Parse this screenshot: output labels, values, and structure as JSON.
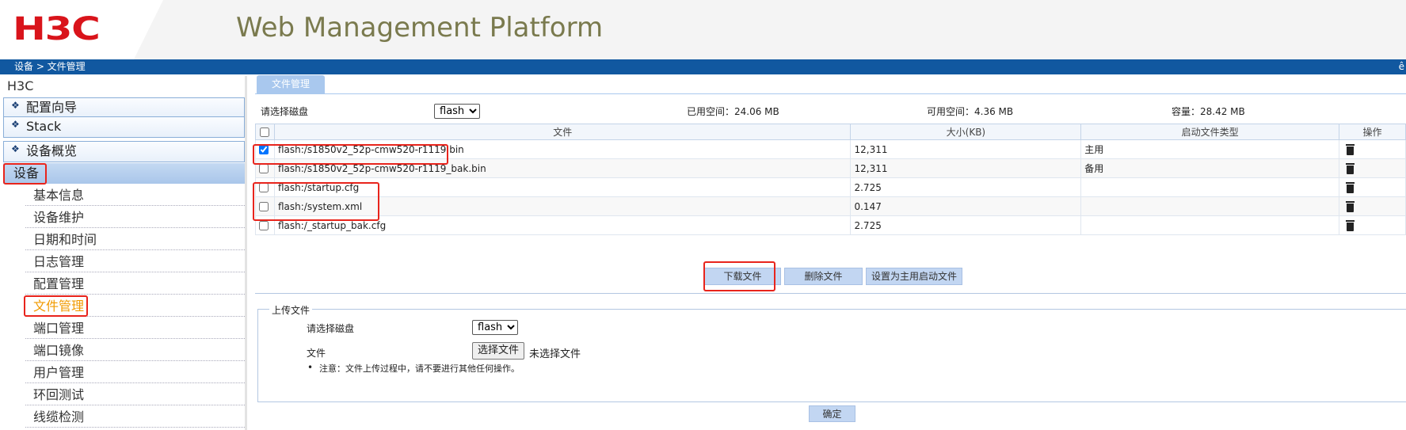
{
  "header": {
    "logo": "H3C",
    "title": "Web Management Platform"
  },
  "navbar": {
    "breadcrumb": "设备 > 文件管理",
    "right_text": "ê"
  },
  "sidebar": {
    "root": "H3C",
    "sections": [
      "配置向导",
      "Stack",
      "设备概览"
    ],
    "device_label": "设备",
    "items": [
      "基本信息",
      "设备维护",
      "日期和时间",
      "日志管理",
      "配置管理",
      "文件管理",
      "端口管理",
      "端口镜像",
      "用户管理",
      "环回测试",
      "线缆检测"
    ],
    "active_item": "文件管理"
  },
  "main": {
    "tab": "文件管理",
    "disk_label": "请选择磁盘",
    "disk_value": "flash",
    "used_space": "已用空间：24.06 MB",
    "free_space": "可用空间：4.36 MB",
    "capacity": "容量：28.42 MB",
    "table": {
      "headers": [
        "文件",
        "大小(KB)",
        "启动文件类型",
        "操作"
      ],
      "rows": [
        {
          "checked": true,
          "file": "flash:/s1850v2_52p-cmw520-r1119.bin",
          "size": "12,311",
          "type": "主用"
        },
        {
          "checked": false,
          "file": "flash:/s1850v2_52p-cmw520-r1119_bak.bin",
          "size": "12,311",
          "type": "备用"
        },
        {
          "checked": false,
          "file": "flash:/startup.cfg",
          "size": "2.725",
          "type": ""
        },
        {
          "checked": false,
          "file": "flash:/system.xml",
          "size": "0.147",
          "type": ""
        },
        {
          "checked": false,
          "file": "flash:/_startup_bak.cfg",
          "size": "2.725",
          "type": ""
        }
      ]
    },
    "buttons": {
      "download": "下载文件",
      "delete": "删除文件",
      "set_main": "设置为主用启动文件"
    },
    "upload": {
      "legend": "上传文件",
      "disk_label": "请选择磁盘",
      "disk_value": "flash",
      "file_label": "文件",
      "choose_file": "选择文件",
      "no_file": "未选择文件",
      "note": "注意：文件上传过程中，请不要进行其他任何操作。",
      "confirm": "确定"
    }
  }
}
